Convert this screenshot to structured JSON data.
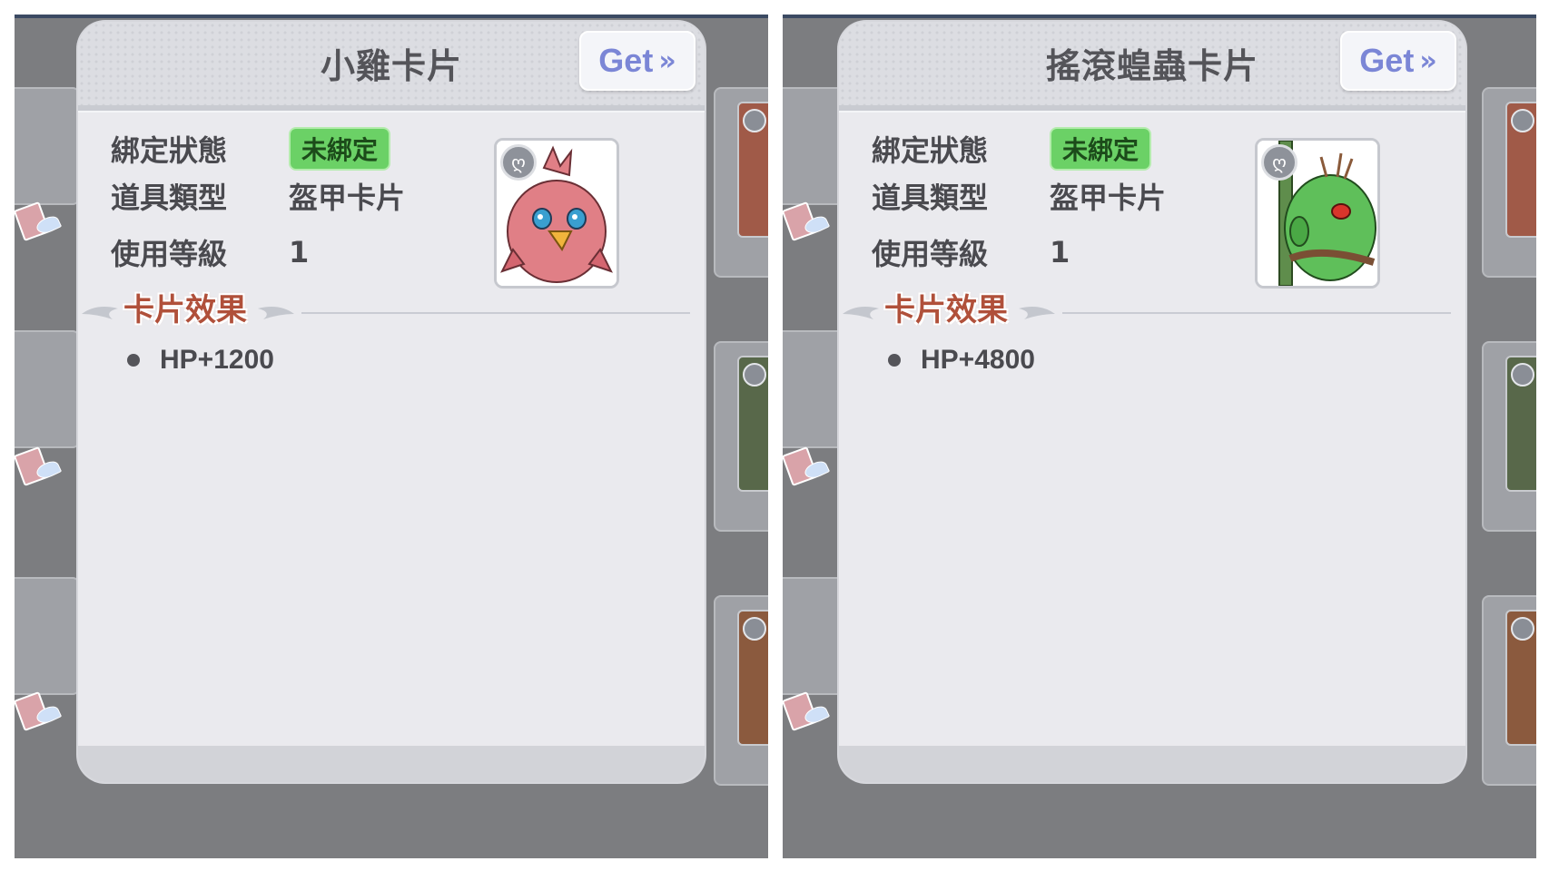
{
  "screens": [
    {
      "title": "小雞卡片",
      "get_label": "Get",
      "get_arrow": "»",
      "bind_state_label": "綁定狀態",
      "bind_state_value": "未綁定",
      "item_type_label": "道具類型",
      "item_type_value": "盔甲卡片",
      "level_label": "使用等級",
      "level_value": "1",
      "section_title": "卡片效果",
      "effects": [
        "HP+1200"
      ],
      "card_art_icon": "red-chick-portrait",
      "accent_color": "#6bd166"
    },
    {
      "title": "搖滾蝗蟲卡片",
      "get_label": "Get",
      "get_arrow": "»",
      "bind_state_label": "綁定狀態",
      "bind_state_value": "未綁定",
      "item_type_label": "道具類型",
      "item_type_value": "盔甲卡片",
      "level_label": "使用等級",
      "level_value": "1",
      "section_title": "卡片效果",
      "effects": [
        "HP+4800"
      ],
      "card_art_icon": "green-grasshopper-portrait",
      "accent_color": "#6bd166"
    }
  ]
}
